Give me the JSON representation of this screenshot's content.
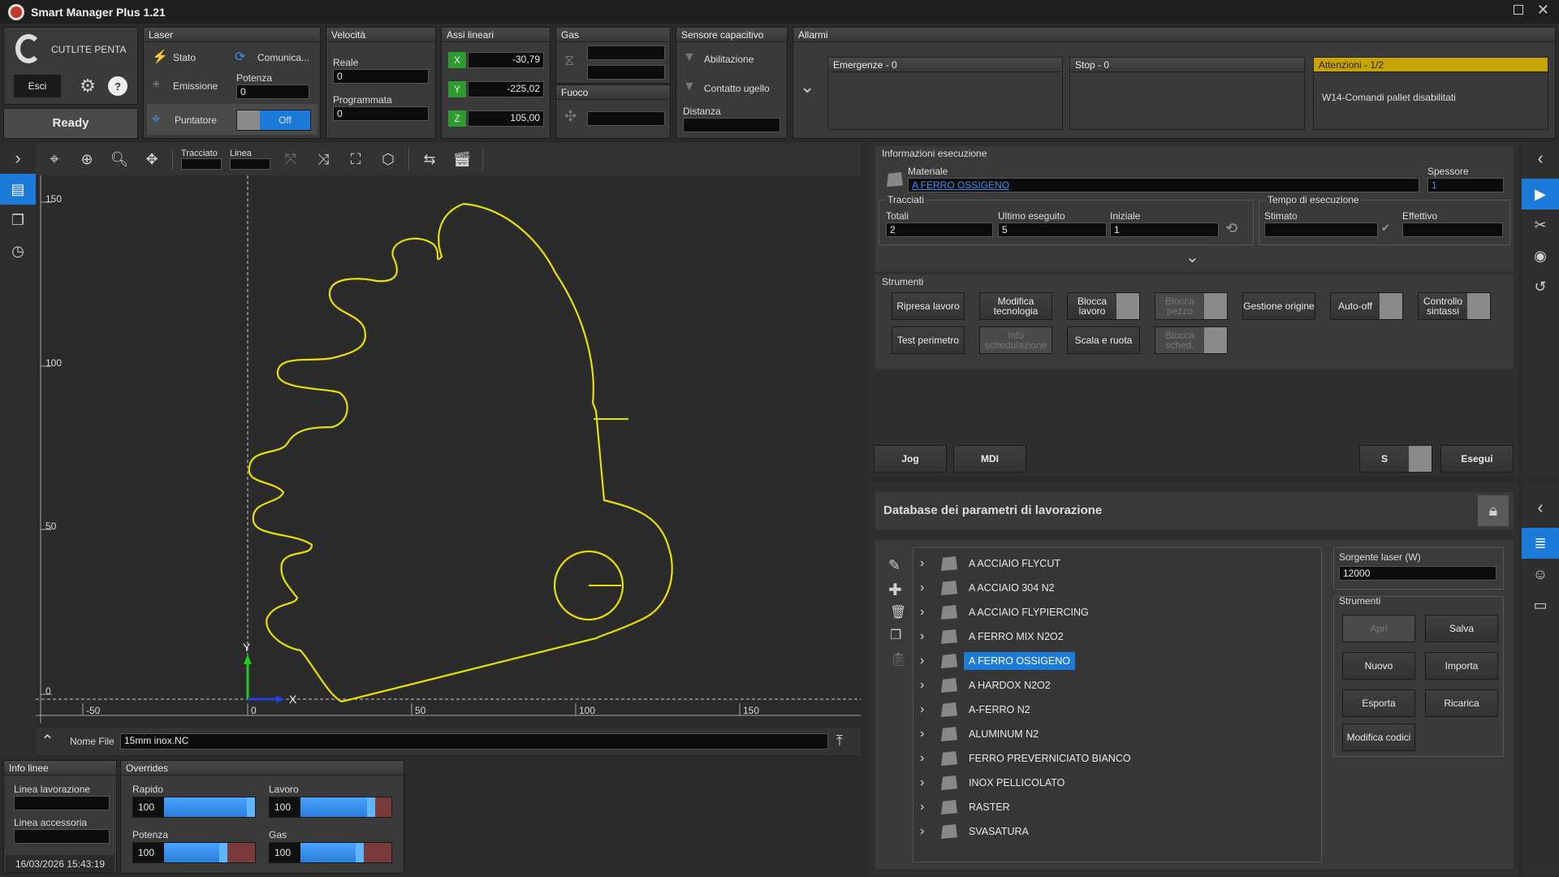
{
  "app": {
    "title": "Smart Manager Plus 1.21"
  },
  "brand": {
    "name": "CUTLITE PENTA",
    "exit": "Esci",
    "status": "Ready"
  },
  "laser": {
    "header": "Laser",
    "stato": "Stato",
    "comunica": "Comunica...",
    "emissione": "Emissione",
    "potenza_label": "Potenza",
    "potenza_value": "0",
    "puntatore": "Puntatore",
    "puntatore_state": "Off"
  },
  "velocita": {
    "header": "Velocità",
    "reale_label": "Reale",
    "reale_value": "0",
    "prog_label": "Programmata",
    "prog_value": "0"
  },
  "assi": {
    "header": "Assi lineari",
    "x_label": "X",
    "x": "-30,79",
    "y_label": "Y",
    "y": "-225,02",
    "z_label": "Z",
    "z": "105,00"
  },
  "gas": {
    "header": "Gas",
    "fuoco": "Fuoco"
  },
  "sensore": {
    "header": "Sensore capacitivo",
    "abilitazione": "Abilitazione",
    "contatto": "Contatto ugello",
    "distanza": "Distanza"
  },
  "allarmi": {
    "header": "Allarmi",
    "emergenze": "Emergenze - 0",
    "stop": "Stop - 0",
    "attenzioni": "Attenzioni - 1/2",
    "attenzioni_msg": "W14-Comandi pallet disabilitati"
  },
  "toolbar": {
    "tracciato": "Tracciato",
    "linea": "Linea"
  },
  "canvas": {
    "yticks": [
      "150",
      "100",
      "50",
      "0"
    ],
    "xticks": [
      "-50",
      "0",
      "50",
      "100",
      "150"
    ],
    "axis_x": "X",
    "axis_y": "Y"
  },
  "file": {
    "label": "Nome File",
    "value": "15mm inox.NC"
  },
  "info_linee": {
    "header": "Info linee",
    "lavorazione": "Linea lavorazione",
    "accessoria": "Linea accessoria",
    "datetime": "16/03/2026 15:43:19"
  },
  "overrides": {
    "header": "Overrides",
    "rapido_label": "Rapido",
    "rapido": "100",
    "lavoro_label": "Lavoro",
    "lavoro": "100",
    "potenza_label": "Potenza",
    "potenza": "100",
    "gas_label": "Gas",
    "gas": "100"
  },
  "esecuzione": {
    "header": "Informazioni esecuzione",
    "materiale_label": "Materiale",
    "materiale": "A FERRO OSSIGENO",
    "spessore_label": "Spessore",
    "spessore": "1",
    "tracciati": "Tracciati",
    "totali_label": "Totali",
    "totali": "2",
    "ultimo_label": "Ultimo eseguito",
    "ultimo": "5",
    "iniziale_label": "Iniziale",
    "iniziale": "1",
    "tempo": "Tempo di esecuzione",
    "stimato": "Stimato",
    "effettivo": "Effettivo"
  },
  "strumenti": {
    "header": "Strumenti",
    "b1": "Ripresa lavoro",
    "b2": "Modifica tecnologia",
    "b3": "Blocca lavoro",
    "b4": "Blocca pezzo",
    "b5": "Gestione origine",
    "b6": "Auto-off",
    "b7": "Controllo sintassi",
    "b8": "Test perimetro",
    "b9": "Info schedulazione",
    "b10": "Scala e ruota",
    "b11": "Blocca sched."
  },
  "bottom_buttons": {
    "jog": "Jog",
    "mdi": "MDI",
    "s": "S",
    "esegui": "Esegui"
  },
  "db": {
    "title": "Database dei parametri di lavorazione",
    "items": [
      "A ACCIAIO  FLYCUT",
      "A ACCIAIO 304 N2",
      "A ACCIAIO FLYPIERCING",
      "A FERRO MIX N2O2",
      "A FERRO OSSIGENO",
      "A HARDOX N2O2",
      "A-FERRO N2",
      "ALUMINUM N2",
      "FERRO PREVERNICIATO BIANCO",
      "INOX PELLICOLATO",
      "RASTER",
      "SVASATURA"
    ],
    "sorgente_label": "Sorgente laser (W)",
    "sorgente": "12000",
    "strumenti": "Strumenti",
    "apri": "Apri",
    "salva": "Salva",
    "nuovo": "Nuovo",
    "importa": "Importa",
    "esporta": "Esporta",
    "ricarica": "Ricarica",
    "modifica_codici": "Modifica codici"
  },
  "colors": {
    "accent": "#1c7ad9",
    "trace": "#e8e000",
    "warning": "#c8a400"
  }
}
